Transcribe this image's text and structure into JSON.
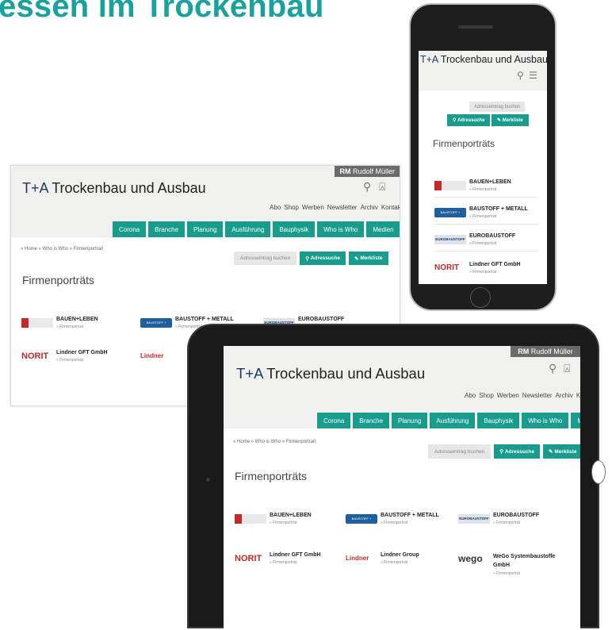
{
  "headline": "essen im Trockenbau",
  "site": {
    "rm_brand": "RM",
    "rm_name": "Rudolf Müller",
    "logo_mark": "T+A",
    "logo_text": "Trockenbau und Ausbau",
    "topnav": [
      "Abo",
      "Shop",
      "Werben",
      "Newsletter",
      "Archiv",
      "Kontakt"
    ],
    "mainnav": [
      "Corona",
      "Branche",
      "Planung",
      "Ausführung",
      "Bauphysik",
      "Who is Who",
      "Medien"
    ],
    "breadcrumb": "» Home  » Who is Who  » Firmenportrait",
    "btn_booking": "Adresseintrag buchen",
    "btn_search": "Adressuche",
    "btn_bookmark": "Merkliste",
    "page_title": "Firmenporträts",
    "firms": [
      {
        "name": "BAUEN+LEBEN",
        "sub": "» Firmenporträt"
      },
      {
        "name": "BAUSTOFF + METALL",
        "sub": "» Firmenporträt"
      },
      {
        "name": "EUROBAUSTOFF",
        "sub": "» Firmenporträt"
      },
      {
        "name": "Lindner GFT GmbH",
        "sub": "» Firmenporträt"
      },
      {
        "name": "Lindner Group",
        "sub": "» Firmenporträt"
      },
      {
        "name": "WeGo Systembaustoffe GmbH",
        "sub": "» Firmenporträt"
      }
    ],
    "logo_labels": {
      "norit": "NORIT",
      "lindner": "Lindner",
      "wego": "wego",
      "baustoff": "BAUSTOFF + METALL",
      "euro": "EUROBAUSTOFF"
    }
  },
  "colors": {
    "accent": "#1aa19c",
    "nav": "#1a9c8c",
    "rm_bar": "#6a6a6a"
  }
}
